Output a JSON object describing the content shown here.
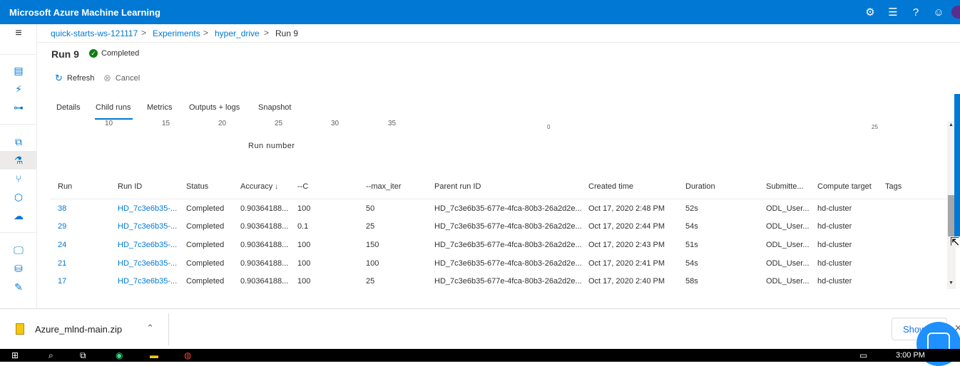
{
  "app": {
    "title": "Microsoft Azure Machine Learning"
  },
  "topbar_icons": [
    "gear-icon",
    "feedback-icon",
    "help-icon",
    "smiley-icon"
  ],
  "breadcrumb": {
    "items": [
      "quick-starts-ws-121117",
      "Experiments",
      "hyper_drive",
      "Run 9"
    ],
    "separator": ">"
  },
  "run": {
    "title": "Run 9",
    "status": "Completed"
  },
  "commands": {
    "refresh": "Refresh",
    "cancel": "Cancel"
  },
  "tabs": [
    "Details",
    "Child runs",
    "Metrics",
    "Outputs + logs",
    "Snapshot"
  ],
  "active_tab": "Child runs",
  "chart_fragment": {
    "x_ticks": [
      "10",
      "15",
      "20",
      "25",
      "30",
      "35"
    ],
    "x_label": "Run number",
    "right_ticks": [
      "0",
      "25"
    ]
  },
  "table": {
    "columns": [
      "Run",
      "Run ID",
      "Status",
      "Accuracy",
      "--C",
      "--max_iter",
      "Parent run ID",
      "Created time",
      "Duration",
      "Submitte...",
      "Compute target",
      "Tags"
    ],
    "sort_indicator": "↓",
    "rows": [
      [
        "38",
        "HD_7c3e6b35-...",
        "Completed",
        "0.90364188...",
        "100",
        "50",
        "HD_7c3e6b35-677e-4fca-80b3-26a2d2e...",
        "Oct 17, 2020 2:48 PM",
        "52s",
        "ODL_User...",
        "hd-cluster",
        ""
      ],
      [
        "29",
        "HD_7c3e6b35-...",
        "Completed",
        "0.90364188...",
        "0.1",
        "25",
        "HD_7c3e6b35-677e-4fca-80b3-26a2d2e...",
        "Oct 17, 2020 2:44 PM",
        "54s",
        "ODL_User...",
        "hd-cluster",
        ""
      ],
      [
        "24",
        "HD_7c3e6b35-...",
        "Completed",
        "0.90364188...",
        "100",
        "150",
        "HD_7c3e6b35-677e-4fca-80b3-26a2d2e...",
        "Oct 17, 2020 2:43 PM",
        "51s",
        "ODL_User...",
        "hd-cluster",
        ""
      ],
      [
        "21",
        "HD_7c3e6b35-...",
        "Completed",
        "0.90364188...",
        "100",
        "100",
        "HD_7c3e6b35-677e-4fca-80b3-26a2d2e...",
        "Oct 17, 2020 2:41 PM",
        "54s",
        "ODL_User...",
        "hd-cluster",
        ""
      ],
      [
        "17",
        "HD_7c3e6b35-...",
        "Completed",
        "0.90364188...",
        "100",
        "25",
        "HD_7c3e6b35-677e-4fca-80b3-26a2d2e...",
        "Oct 17, 2020 2:40 PM",
        "58s",
        "ODL_User...",
        "hd-cluster",
        ""
      ]
    ]
  },
  "downloads": {
    "file": "Azure_mlnd-main.zip",
    "show_all": "Show"
  },
  "taskbar": {
    "time": "3:00 PM"
  },
  "colors": {
    "brand": "#0078d4",
    "success": "#107c10",
    "link": "#0078d4"
  }
}
